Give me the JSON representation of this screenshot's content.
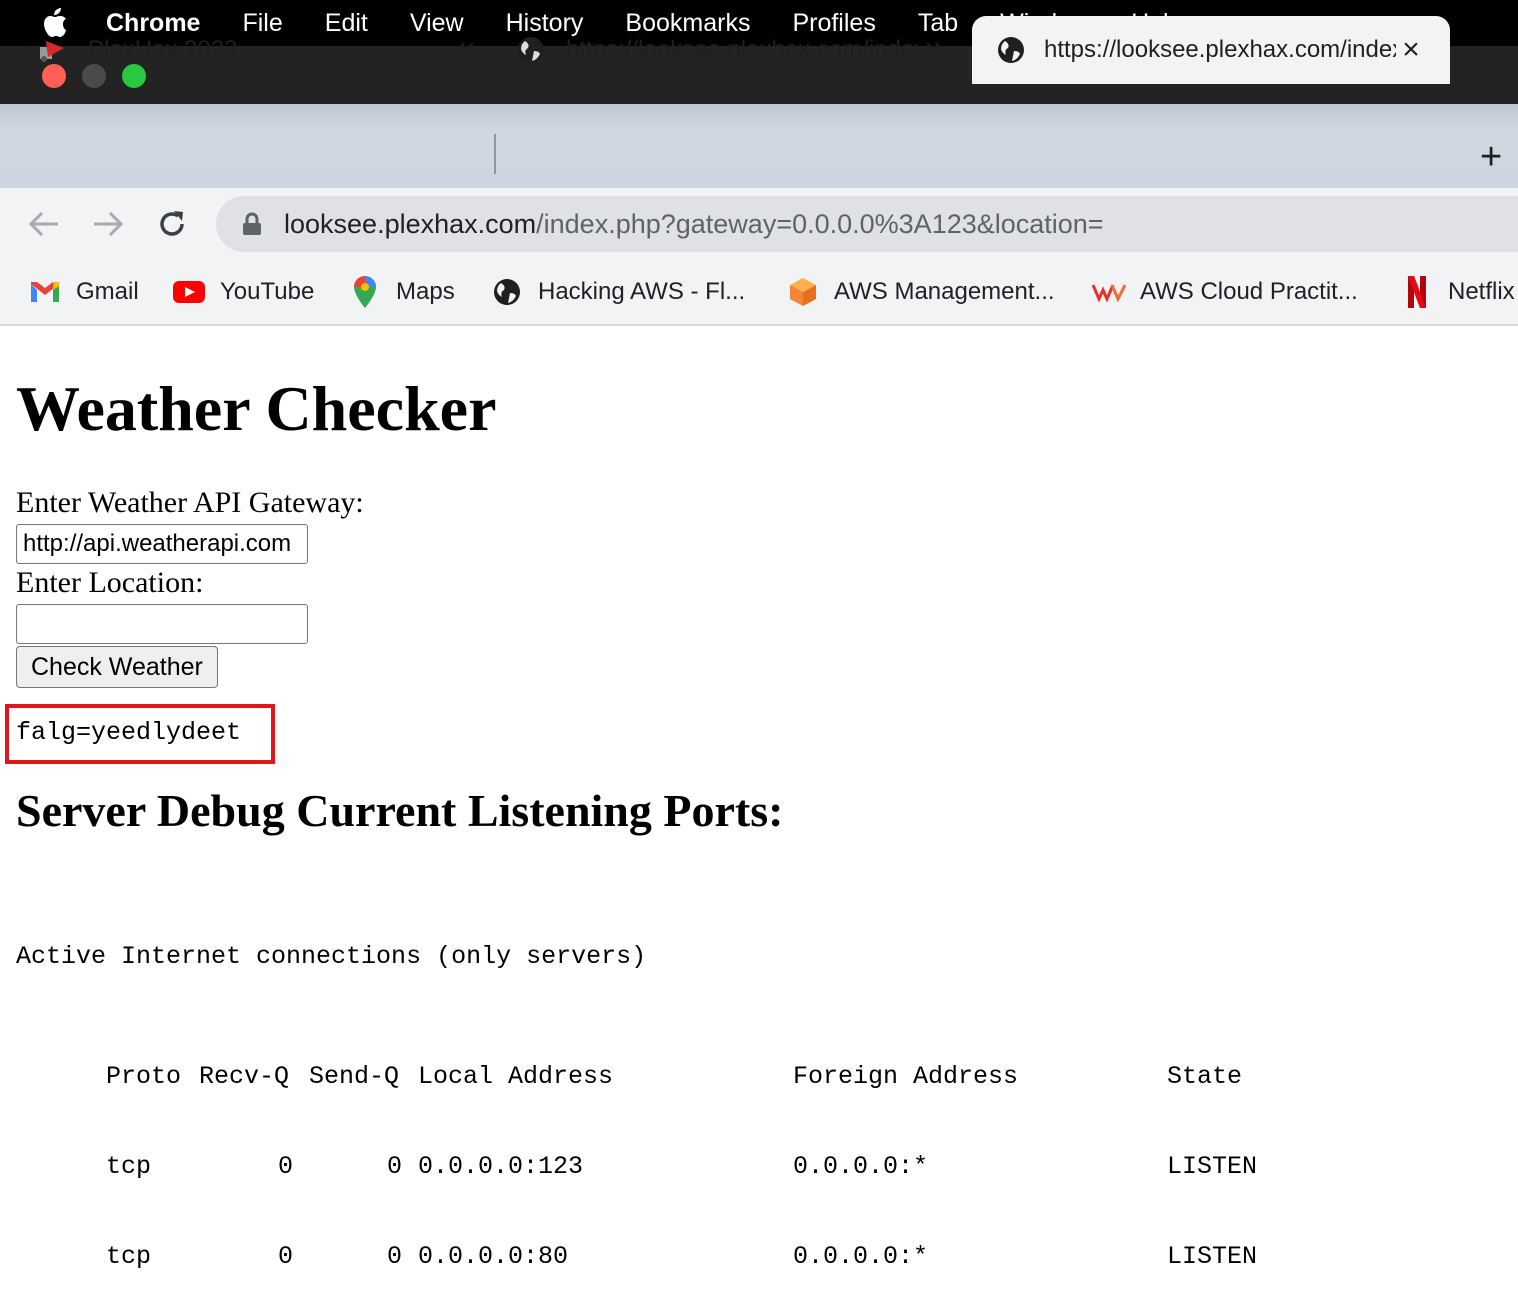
{
  "menubar": {
    "app": "Chrome",
    "items": [
      "File",
      "Edit",
      "View",
      "History",
      "Bookmarks",
      "Profiles",
      "Tab",
      "Window",
      "Help"
    ]
  },
  "tabs": [
    {
      "title": "PlexHax 2023",
      "icon": "plexhax-icon",
      "active": false
    },
    {
      "title": "https://looksee.plexhax.com/index.php",
      "icon": "globe-icon",
      "active": false
    },
    {
      "title": "https://looksee.plexhax.com/index.php",
      "icon": "globe-icon",
      "active": true
    }
  ],
  "omnibox": {
    "host": "looksee.plexhax.com",
    "path": "/index.php?gateway=0.0.0.0%3A123&location="
  },
  "bookmarks": [
    {
      "label": "Gmail",
      "icon": "gmail-icon"
    },
    {
      "label": "YouTube",
      "icon": "youtube-icon"
    },
    {
      "label": "Maps",
      "icon": "maps-icon"
    },
    {
      "label": "Hacking AWS - Fl...",
      "icon": "globe-icon"
    },
    {
      "label": "AWS Management...",
      "icon": "aws-cube-icon"
    },
    {
      "label": "AWS Cloud Practit...",
      "icon": "wc-icon"
    },
    {
      "label": "Netflix",
      "icon": "netflix-icon"
    }
  ],
  "page": {
    "title": "Weather Checker",
    "gateway_label": "Enter Weather API Gateway:",
    "gateway_value": "http://api.weatherapi.com",
    "location_label": "Enter Location:",
    "location_value": "",
    "button_label": "Check Weather",
    "flag_output": "falg=yeedlydeet",
    "debug_title": "Server Debug Current Listening Ports:",
    "netstat_header": "Active Internet connections (only servers)",
    "netstat_columns": [
      "Proto",
      "Recv-Q",
      "Send-Q",
      "Local Address",
      "Foreign Address",
      "State"
    ],
    "netstat_rows": [
      [
        "tcp",
        "0",
        "0",
        "0.0.0.0:123",
        "0.0.0.0:*",
        "LISTEN"
      ],
      [
        "tcp",
        "0",
        "0",
        "0.0.0.0:80",
        "0.0.0.0:*",
        "LISTEN"
      ]
    ]
  },
  "colors": {
    "highlight_border": "#e3151a",
    "traffic_red": "#ff5f57",
    "traffic_green": "#28c840"
  }
}
